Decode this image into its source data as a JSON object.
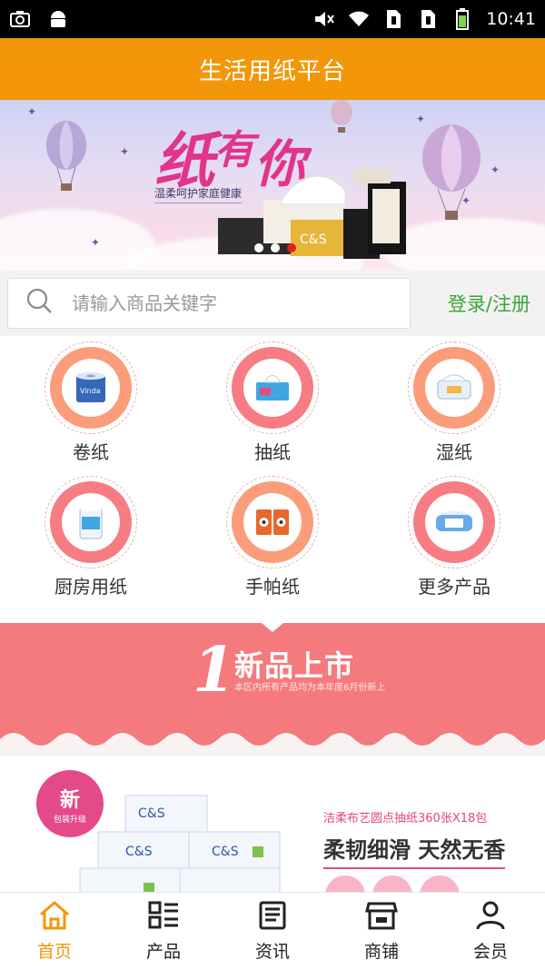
{
  "status_bar": {
    "time": "10:41"
  },
  "header": {
    "title": "生活用纸平台"
  },
  "banner": {
    "title_big": "纸",
    "title_mid": "有",
    "title_small": "你",
    "tagline": "温柔呵护家庭健康",
    "active_slide": 2,
    "slide_count": 3
  },
  "search": {
    "placeholder": "请输入商品关键字",
    "login_label": "登录/注册"
  },
  "categories": [
    {
      "label": "卷纸",
      "icon": "toilet-roll-icon",
      "color": "#fb9c7a"
    },
    {
      "label": "抽纸",
      "icon": "tissue-box-icon",
      "color": "#f87c83"
    },
    {
      "label": "湿纸",
      "icon": "wet-wipe-icon",
      "color": "#fb9c7a"
    },
    {
      "label": "厨房用纸",
      "icon": "kitchen-roll-icon",
      "color": "#f87c83"
    },
    {
      "label": "手帕纸",
      "icon": "handkerchief-icon",
      "color": "#fb9c7a"
    },
    {
      "label": "更多产品",
      "icon": "more-products-icon",
      "color": "#f87c83"
    }
  ],
  "new_products": {
    "number": "1",
    "title": "新品上市",
    "subtitle": "本区内所有产品均为本年度6月份新上",
    "bg_color": "#f47a7e"
  },
  "featured": {
    "badge_main": "新",
    "badge_sub": "包装升级",
    "name": "洁柔布艺圆点抽纸360张X18包",
    "slogan": "柔韧细滑 天然无香"
  },
  "bottom_nav": [
    {
      "label": "首页",
      "icon": "home-icon",
      "active": true
    },
    {
      "label": "产品",
      "icon": "grid-list-icon",
      "active": false
    },
    {
      "label": "资讯",
      "icon": "news-icon",
      "active": false
    },
    {
      "label": "商铺",
      "icon": "store-icon",
      "active": false
    },
    {
      "label": "会员",
      "icon": "user-icon",
      "active": false
    }
  ],
  "colors": {
    "accent": "#f29709",
    "login_green": "#3aa63a",
    "pink": "#e04a7a"
  }
}
